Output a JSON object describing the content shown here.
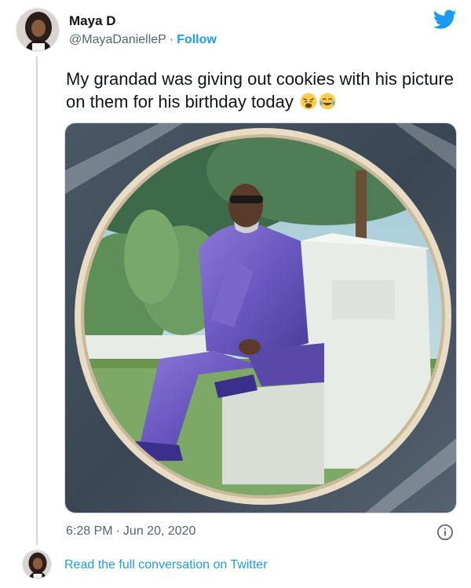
{
  "author": {
    "display_name": "Maya D",
    "handle": "@MayaDanielleP",
    "separator": "·",
    "follow_label": "Follow"
  },
  "tweet": {
    "text": "My grandad was giving out cookies with his picture on them for his birthday today",
    "emojis": [
      "weary-face-emoji",
      "tears-of-joy-emoji"
    ],
    "time": "6:28 PM",
    "separator": "·",
    "date": "Jun 20, 2020"
  },
  "footer": {
    "link_label": "Read the full conversation on Twitter"
  },
  "icons": {
    "brand": "twitter-bird-icon",
    "info": "info-icon"
  },
  "colors": {
    "accent": "#1d9bf0",
    "text": "#0f1419",
    "secondary": "#536471",
    "border": "#cfd9de"
  }
}
